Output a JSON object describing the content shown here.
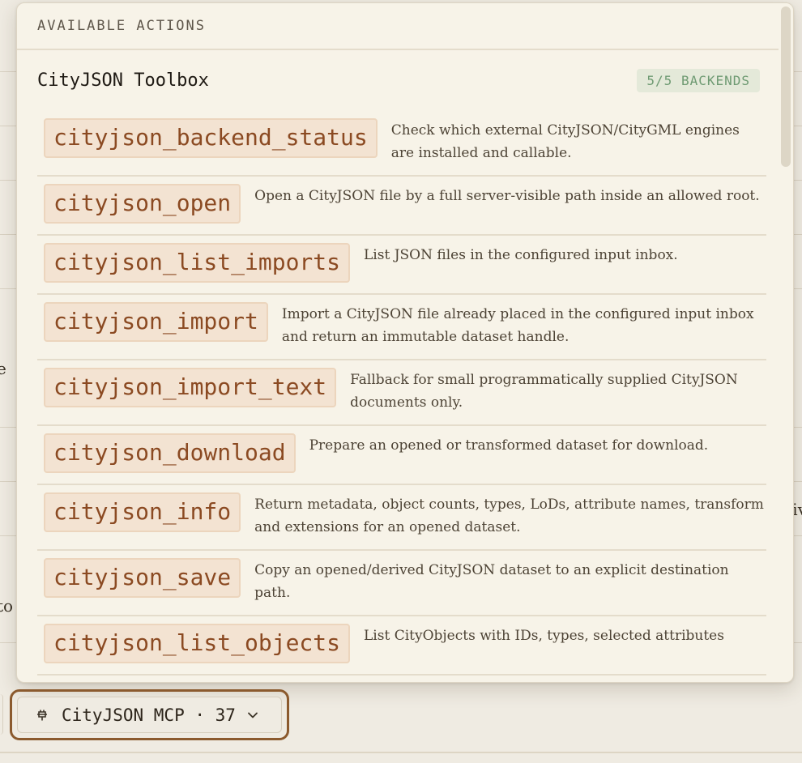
{
  "popover": {
    "header": "AVAILABLE ACTIONS",
    "group": {
      "title": "CityJSON Toolbox",
      "badge": "5/5 BACKENDS"
    },
    "tools": [
      {
        "name": "cityjson_backend_status",
        "description": "Check which external CityJSON/CityGML engines are installed and callable."
      },
      {
        "name": "cityjson_open",
        "description": "Open a CityJSON file by a full server-visible path inside an allowed root."
      },
      {
        "name": "cityjson_list_imports",
        "description": "List JSON files in the configured input inbox."
      },
      {
        "name": "cityjson_import",
        "description": "Import a CityJSON file already placed in the configured input inbox and return an immutable dataset handle."
      },
      {
        "name": "cityjson_import_text",
        "description": "Fallback for small programmatically supplied CityJSON documents only."
      },
      {
        "name": "cityjson_download",
        "description": "Prepare an opened or transformed dataset for download."
      },
      {
        "name": "cityjson_info",
        "description": "Return metadata, object counts, types, LoDs, attribute names, transform and extensions for an opened dataset."
      },
      {
        "name": "cityjson_save",
        "description": "Copy an opened/derived CityJSON dataset to an explicit destination path."
      },
      {
        "name": "cityjson_list_objects",
        "description": "List CityObjects with IDs, types, selected attributes"
      }
    ]
  },
  "selector": {
    "icon": "plug-icon",
    "label": "CityJSON MCP · 37",
    "chevron": "chevron-down-icon"
  },
  "background": {
    "fragments": [
      "e",
      "iv",
      "to"
    ]
  }
}
